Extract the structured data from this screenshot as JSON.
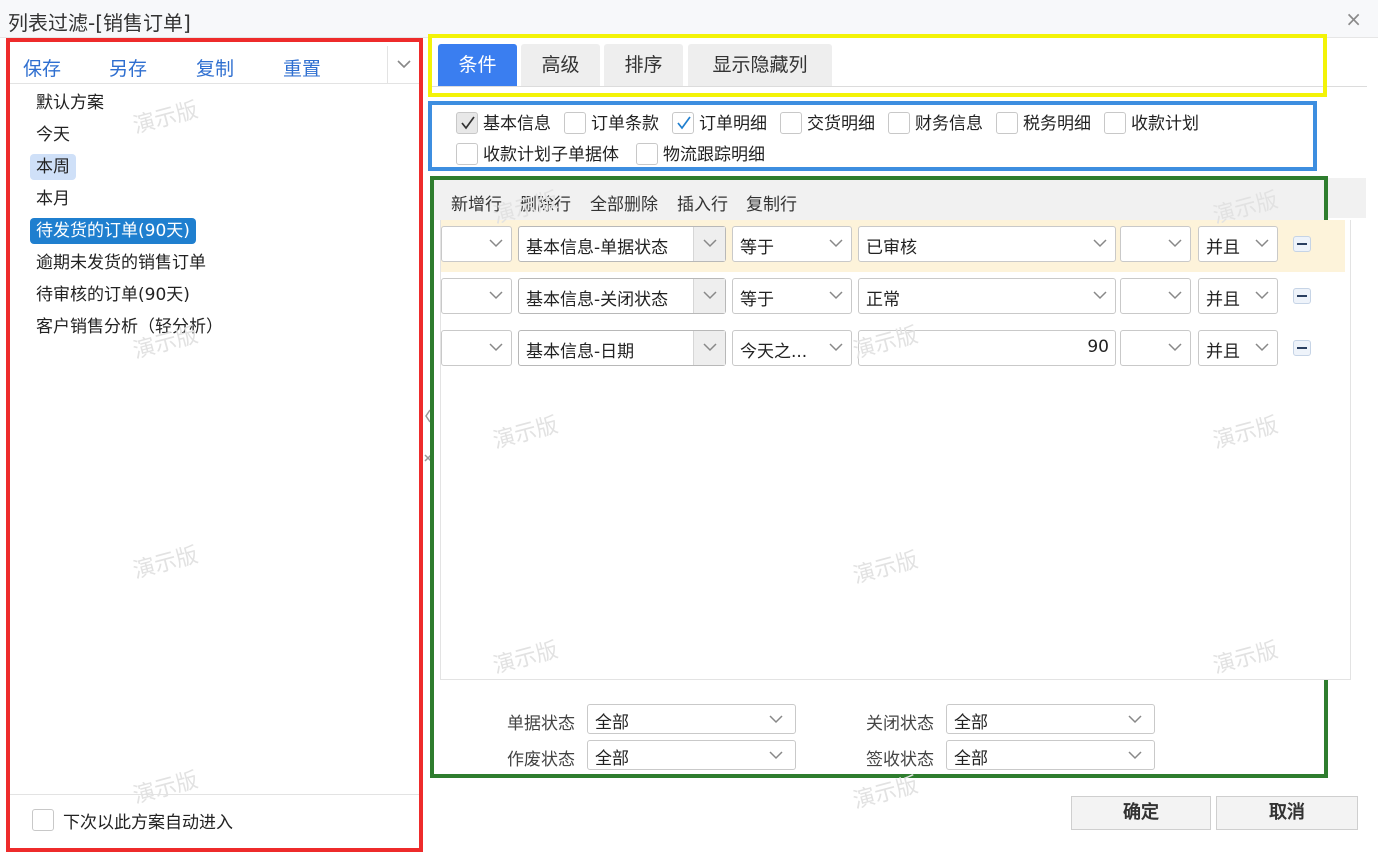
{
  "window": {
    "title": "列表过滤-[销售订单]",
    "close_glyph": "×"
  },
  "scheme": {
    "toolbar": {
      "save": "保存",
      "save_as": "另存",
      "copy": "复制",
      "reset": "重置"
    },
    "items": [
      {
        "label": "默认方案",
        "state": "normal"
      },
      {
        "label": "今天",
        "state": "normal"
      },
      {
        "label": "本周",
        "state": "hover"
      },
      {
        "label": "本月",
        "state": "normal"
      },
      {
        "label": "待发货的订单(90天)",
        "state": "selected"
      },
      {
        "label": "逾期未发货的销售订单",
        "state": "normal"
      },
      {
        "label": "待审核的订单(90天)",
        "state": "normal"
      },
      {
        "label": "客户销售分析（轻分析）",
        "state": "normal"
      }
    ],
    "auto_enter_label": "下次以此方案自动进入",
    "auto_enter_checked": false
  },
  "tabs": [
    {
      "label": "条件",
      "active": true
    },
    {
      "label": "高级",
      "active": false
    },
    {
      "label": "排序",
      "active": false
    },
    {
      "label": "显示隐藏列",
      "active": false
    }
  ],
  "entities": [
    {
      "label": "基本信息",
      "checked": true
    },
    {
      "label": "订单条款",
      "checked": false
    },
    {
      "label": "订单明细",
      "checked": true
    },
    {
      "label": "交货明细",
      "checked": false
    },
    {
      "label": "财务信息",
      "checked": false
    },
    {
      "label": "税务明细",
      "checked": false
    },
    {
      "label": "收款计划",
      "checked": false
    },
    {
      "label": "收款计划子单据体",
      "checked": false
    },
    {
      "label": "物流跟踪明细",
      "checked": false
    }
  ],
  "conditions": {
    "toolbar": {
      "add_row": "新增行",
      "delete_row": "删除行",
      "delete_all": "全部删除",
      "insert_row": "插入行",
      "copy_row": "复制行"
    },
    "rows": [
      {
        "left_paren": "",
        "field": "基本信息-单据状态",
        "operator": "等于",
        "value": "已审核",
        "right_paren": "",
        "logic": "并且",
        "highlighted": true
      },
      {
        "left_paren": "",
        "field": "基本信息-关闭状态",
        "operator": "等于",
        "value": "正常",
        "right_paren": "",
        "logic": "并且",
        "highlighted": false
      },
      {
        "left_paren": "",
        "field": "基本信息-日期",
        "operator": "今天之...",
        "value": "90",
        "right_paren": "",
        "logic": "并且",
        "highlighted": false
      }
    ]
  },
  "quick_filters": {
    "bill_status_label": "单据状态",
    "bill_status_value": "全部",
    "close_status_label": "关闭状态",
    "close_status_value": "全部",
    "void_status_label": "作废状态",
    "void_status_value": "全部",
    "sign_status_label": "签收状态",
    "sign_status_value": "全部"
  },
  "actions": {
    "ok": "确定",
    "cancel": "取消"
  },
  "watermark_text": "演示版"
}
